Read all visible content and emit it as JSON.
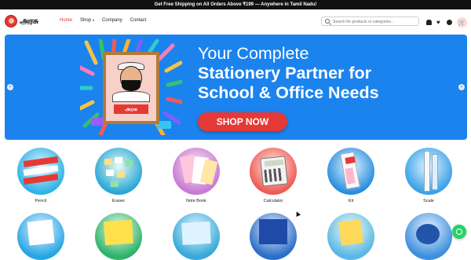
{
  "topbar": {
    "text": "Get Free Shipping on All Orders Above ₹199 — Anywhere in Tamil Nadu!"
  },
  "brand": {
    "name": "அரசு",
    "tagline": "stationery",
    "icon": "logo-icon"
  },
  "nav": {
    "items": [
      {
        "label": "Home",
        "active": true
      },
      {
        "label": "Shop",
        "caret": "▾"
      },
      {
        "label": "Company"
      },
      {
        "label": "Contact"
      }
    ]
  },
  "search": {
    "placeholder": "Search for products or categories...",
    "icon": "search-icon"
  },
  "header_icons": [
    "bell-icon",
    "heart-icon",
    "user-icon",
    "cart-icon"
  ],
  "banner": {
    "line1": "Your Complete",
    "line2": "Stationery Partner for",
    "line3": "School & Office Needs",
    "cta": "SHOP NOW",
    "frame_brand": "அரசு",
    "prev": "‹",
    "next": "›",
    "colors": {
      "background": "#1b83ee",
      "cta": "#e53935"
    }
  },
  "categories": [
    {
      "label": "Pencil",
      "icon": "pencil-icon"
    },
    {
      "label": "Eraser",
      "icon": "eraser-icon"
    },
    {
      "label": "Note Book",
      "icon": "notebook-icon"
    },
    {
      "label": "Calculator",
      "icon": "calculator-icon"
    },
    {
      "label": "Kit",
      "icon": "kit-icon"
    },
    {
      "label": "Scale",
      "icon": "scale-icon"
    }
  ],
  "colors": {
    "accent": "#e53935",
    "topbar": "#111111",
    "whatsapp": "#25d366"
  }
}
